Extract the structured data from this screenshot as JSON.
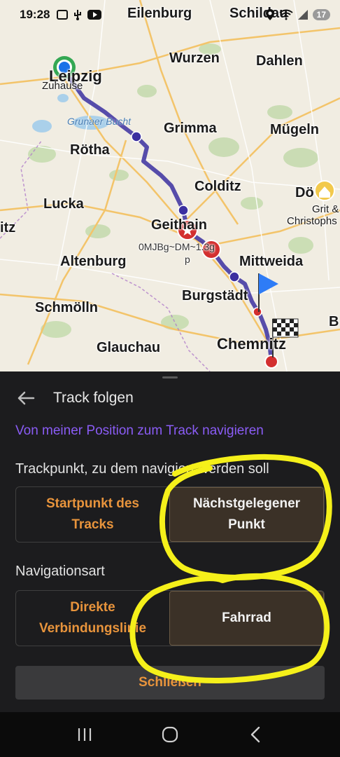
{
  "status": {
    "time": "19:28",
    "battery": "17",
    "icons": [
      "screenshot-icon",
      "usb-icon",
      "youtube-icon"
    ],
    "right_icons": [
      "location-icon",
      "wifi-icon",
      "signal-icon"
    ]
  },
  "map": {
    "cities": {
      "eilenburg": "Eilenburg",
      "schildau": "Schildau",
      "leipzig": "Leipzig",
      "zuhause": "Zuhause",
      "wurzen": "Wurzen",
      "dahlen": "Dahlen",
      "grimma": "Grimma",
      "mugeln": "Mügeln",
      "rotha": "Rötha",
      "colditz": "Colditz",
      "dobeln": "Dö",
      "grit": "Grit &",
      "christophs": "Christophs",
      "lucka": "Lucka",
      "itz": "itz",
      "geithain": "Geithain",
      "waypoint": "0MJBg~DM~1.3g",
      "waypoint2": "p",
      "mittweida": "Mittweida",
      "altenburg": "Altenburg",
      "burgstadt": "Burgstädt",
      "schmolln": "Schmölln",
      "glauchau": "Glauchau",
      "chemnitz": "Chemnitz",
      "b": "B"
    },
    "water": "Grunaer Bucht"
  },
  "sheet": {
    "title": "Track folgen",
    "nav_link": "Von meiner Position zum Track navigieren",
    "trackpoint_label": "Trackpunkt, zu dem navigiert werden soll",
    "trackpoint_options": [
      {
        "label": "Startpunkt des Tracks",
        "selected": false
      },
      {
        "label": "Nächstgelegener Punkt",
        "selected": true
      }
    ],
    "navtype_label": "Navigationsart",
    "navtype_options": [
      {
        "label": "Direkte Verbindungslinie",
        "selected": false
      },
      {
        "label": "Fahrrad",
        "selected": true
      }
    ],
    "close_label": "Schließen"
  },
  "colors": {
    "accent_orange": "#e8943c",
    "link_purple": "#8a5cf5",
    "annotation_yellow": "#f5f01a",
    "track_purple": "#5a4fb8"
  }
}
